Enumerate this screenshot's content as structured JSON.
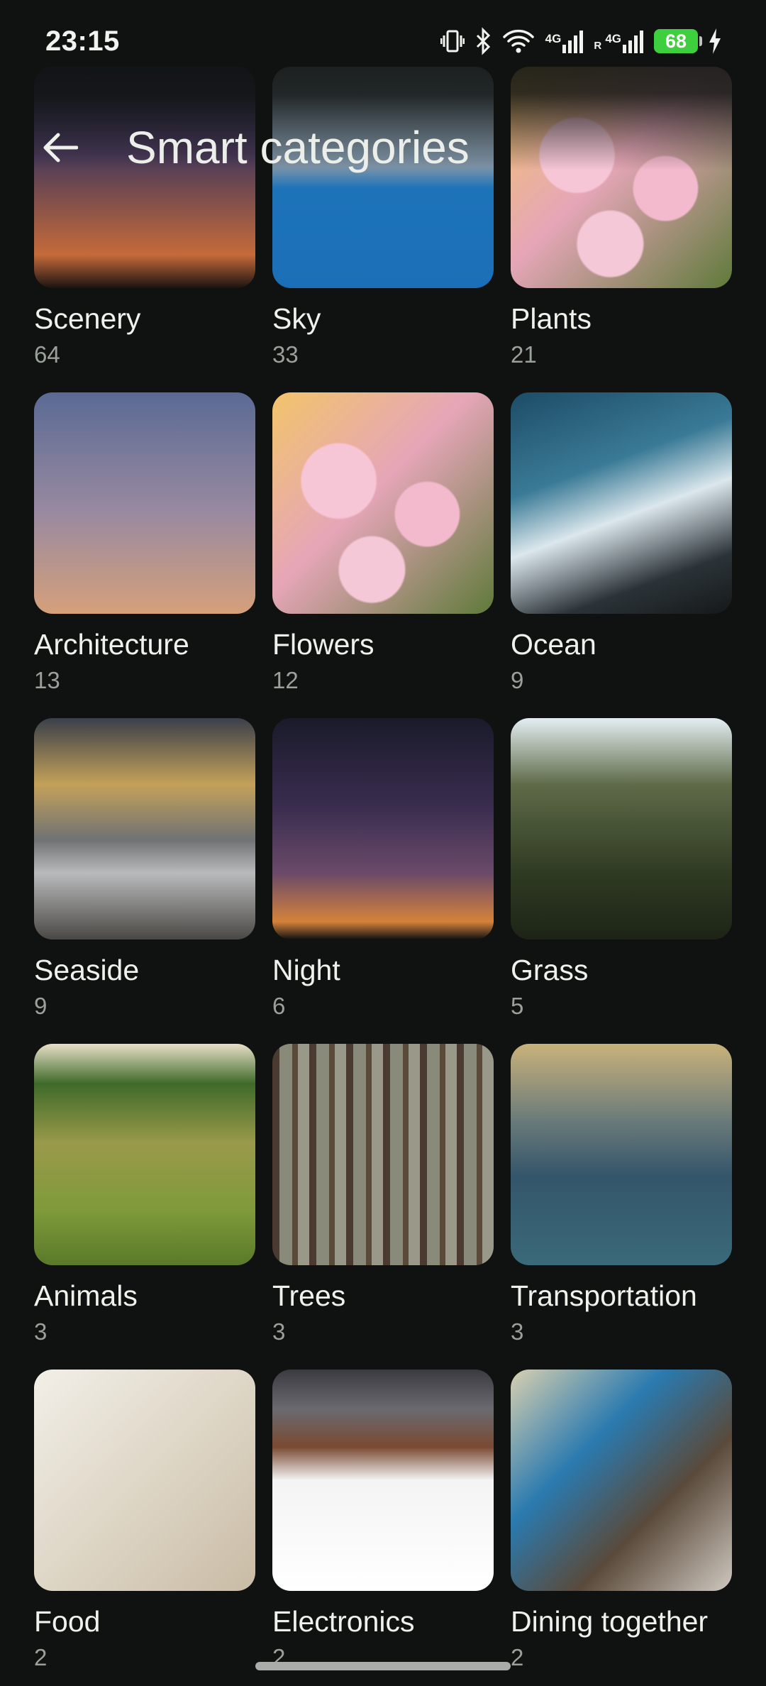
{
  "status_bar": {
    "time": "23:15",
    "battery_percent": "68",
    "network_1": "4G",
    "network_2": "4G",
    "roaming": "R"
  },
  "header": {
    "title": "Smart categories"
  },
  "categories": [
    {
      "name": "Scenery",
      "count": "64",
      "thumb": "t-scenery"
    },
    {
      "name": "Sky",
      "count": "33",
      "thumb": "t-sky"
    },
    {
      "name": "Plants",
      "count": "21",
      "thumb": "t-plants"
    },
    {
      "name": "Architecture",
      "count": "13",
      "thumb": "t-architecture"
    },
    {
      "name": "Flowers",
      "count": "12",
      "thumb": "t-flowers"
    },
    {
      "name": "Ocean",
      "count": "9",
      "thumb": "t-ocean"
    },
    {
      "name": "Seaside",
      "count": "9",
      "thumb": "t-seaside"
    },
    {
      "name": "Night",
      "count": "6",
      "thumb": "t-night"
    },
    {
      "name": "Grass",
      "count": "5",
      "thumb": "t-grass"
    },
    {
      "name": "Animals",
      "count": "3",
      "thumb": "t-animals"
    },
    {
      "name": "Trees",
      "count": "3",
      "thumb": "t-trees"
    },
    {
      "name": "Transportation",
      "count": "3",
      "thumb": "t-transportation"
    },
    {
      "name": "Food",
      "count": "2",
      "thumb": "t-food"
    },
    {
      "name": "Electronics",
      "count": "2",
      "thumb": "t-electronics"
    },
    {
      "name": "Dining together",
      "count": "2",
      "thumb": "t-dining"
    }
  ],
  "colors": {
    "background": "#0f1210",
    "battery": "#3dcf3d",
    "text_primary": "#eef1ec",
    "text_secondary": "#9aa09a"
  }
}
